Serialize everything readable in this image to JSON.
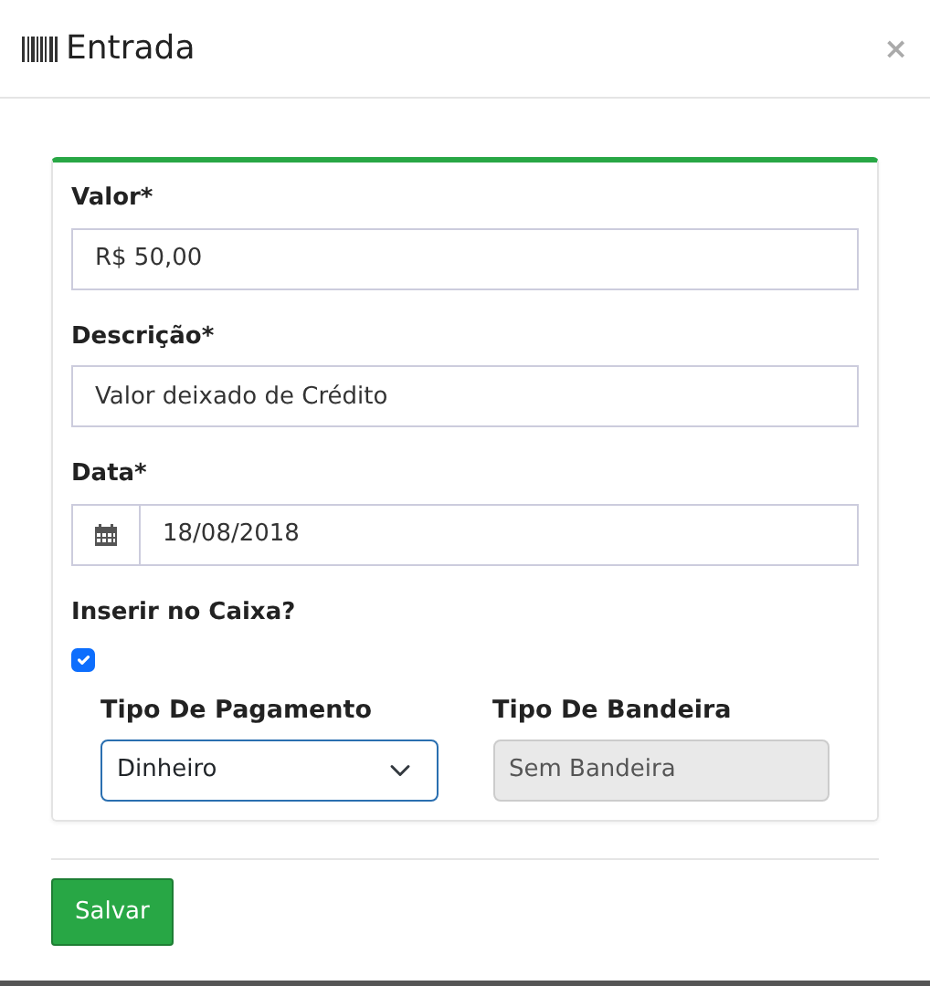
{
  "modal": {
    "title": "Entrada",
    "close": "×"
  },
  "fields": [
    {
      "kind": "text",
      "label": "Valor*",
      "value": "R$ 50,00"
    },
    {
      "kind": "text",
      "label": "Descrição*",
      "value": "Valor deixado de Crédito"
    },
    {
      "kind": "date",
      "label": "Data*",
      "value": "18/08/2018"
    }
  ],
  "checkbox": {
    "label": "Inserir no Caixa?",
    "checked": true
  },
  "selects": [
    {
      "label": "Tipo De Pagamento",
      "value": "Dinheiro",
      "focused": true,
      "disabled": false
    },
    {
      "label": "Tipo De Bandeira",
      "value": "Sem Bandeira",
      "focused": false,
      "disabled": true
    }
  ],
  "buttons": [
    {
      "label": "Salvar"
    }
  ]
}
